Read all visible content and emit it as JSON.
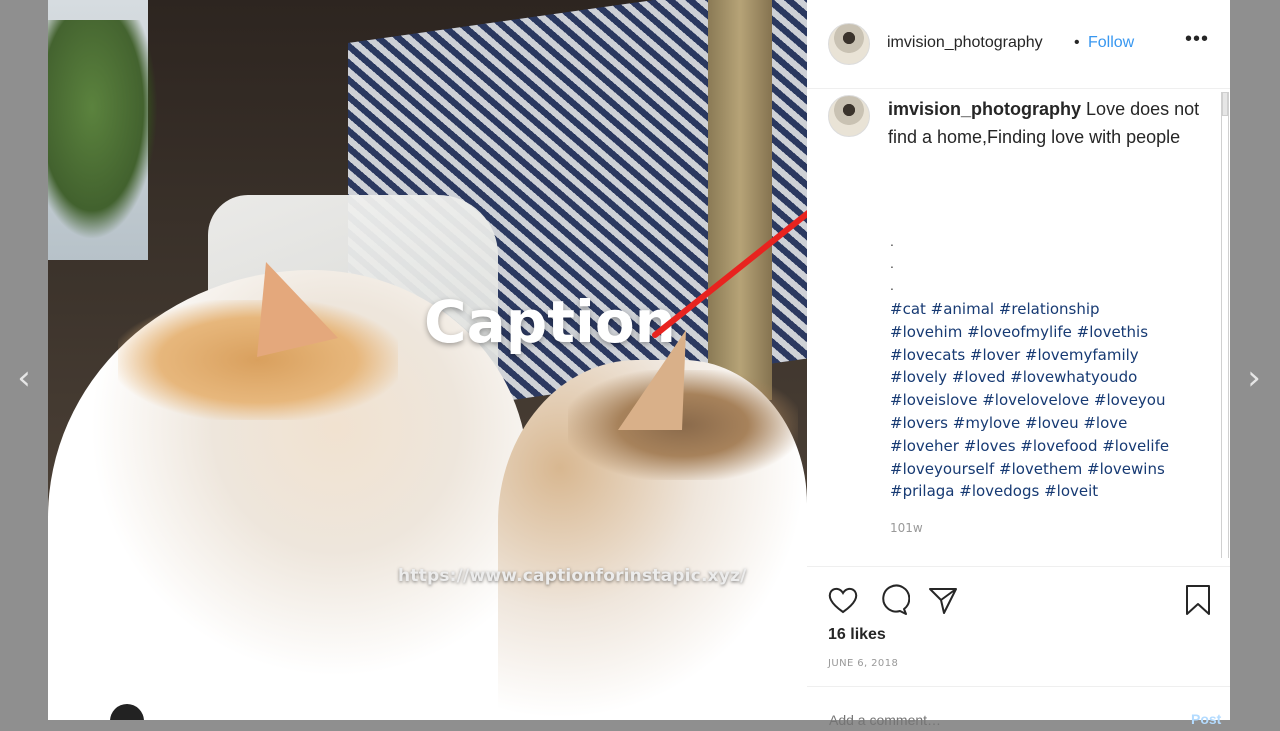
{
  "colors": {
    "backdrop": "#8f8f8f",
    "follow": "#3897f0",
    "hashtag": "#173a73",
    "arrow": "#e8231f"
  },
  "nav": {
    "prev_icon": "chevron-left-icon",
    "next_icon": "chevron-right-icon",
    "prev": "‹",
    "next": "›"
  },
  "photo": {
    "overlay_title": "Caption",
    "overlay_url": "https://www.captionforinstapic.xyz/"
  },
  "post": {
    "username": "imvision_photography",
    "separator": "•",
    "follow_label": "Follow",
    "more_label": "•••",
    "caption_user": "imvision_photography",
    "caption_text": "Love does not find a home,Finding love with people",
    "dots": [
      ".",
      ".",
      "."
    ],
    "hashtags": [
      "#cat #animal #relationship",
      "#lovehim #loveofmylife #lovethis",
      "#lovecats #lover #lovemyfamily",
      "#lovely #loved #lovewhatyoudo",
      "#loveislove #lovelovelove #loveyou",
      "#lovers #mylove #loveu #love",
      "#loveher #loves #lovefood #lovelife",
      "#loveyourself #lovethem #lovewins",
      "#prilaga #lovedogs #loveit"
    ],
    "time_ago": "101w",
    "likes": "16 likes",
    "date": "JUNE 6, 2018",
    "add_comment_placeholder": "Add a comment…",
    "post_label": "Post",
    "icons": [
      "heart-icon",
      "comment-icon",
      "share-icon",
      "bookmark-icon"
    ]
  }
}
